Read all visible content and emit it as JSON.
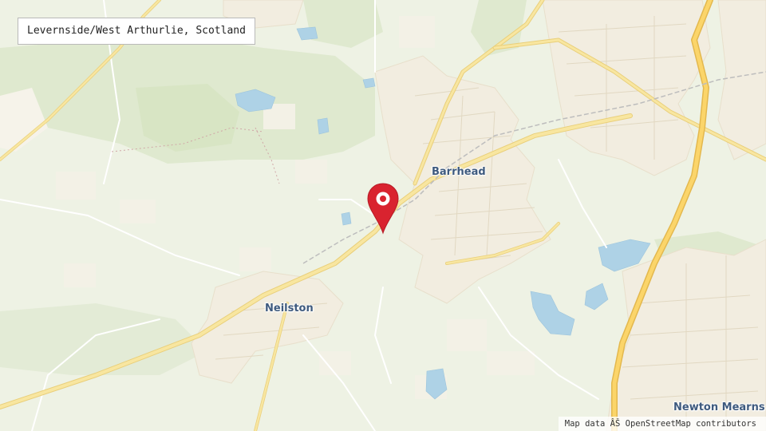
{
  "location_title": "Levernside/West Arthurlie, Scotland",
  "places": {
    "barrhead": "Barrhead",
    "neilston": "Neilston",
    "newton_mearns": "Newton Mearns"
  },
  "attribution": "Map data ÂŠ OpenStreetMap contributors",
  "icons": {
    "marker": "map-pin-icon"
  },
  "colors": {
    "land": "#eef2e4",
    "urban": "#f3eedf",
    "woodland": "#dde8cc",
    "water": "#aed2e6",
    "road_major": "#f6df8c",
    "marker": "#d9232f"
  }
}
